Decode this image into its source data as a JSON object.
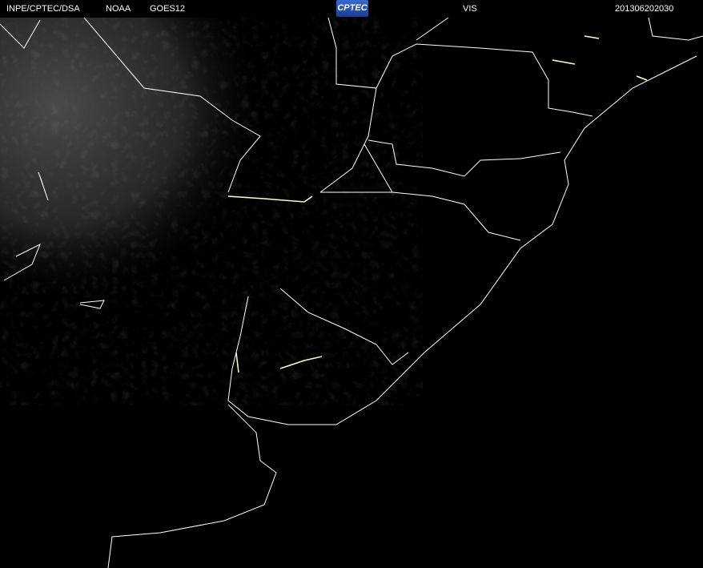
{
  "header": {
    "agency": "INPE/CPTEC/DSA",
    "provider": "NOAA",
    "satellite": "GOES12",
    "logo": "CPTEC",
    "channel": "VIS",
    "timestamp": "201306202030"
  },
  "colors": {
    "background": "#000000",
    "borders": "#ffffff",
    "coast_highlight": "#ffffcc",
    "cloud_haze": "#3a3a3a"
  }
}
